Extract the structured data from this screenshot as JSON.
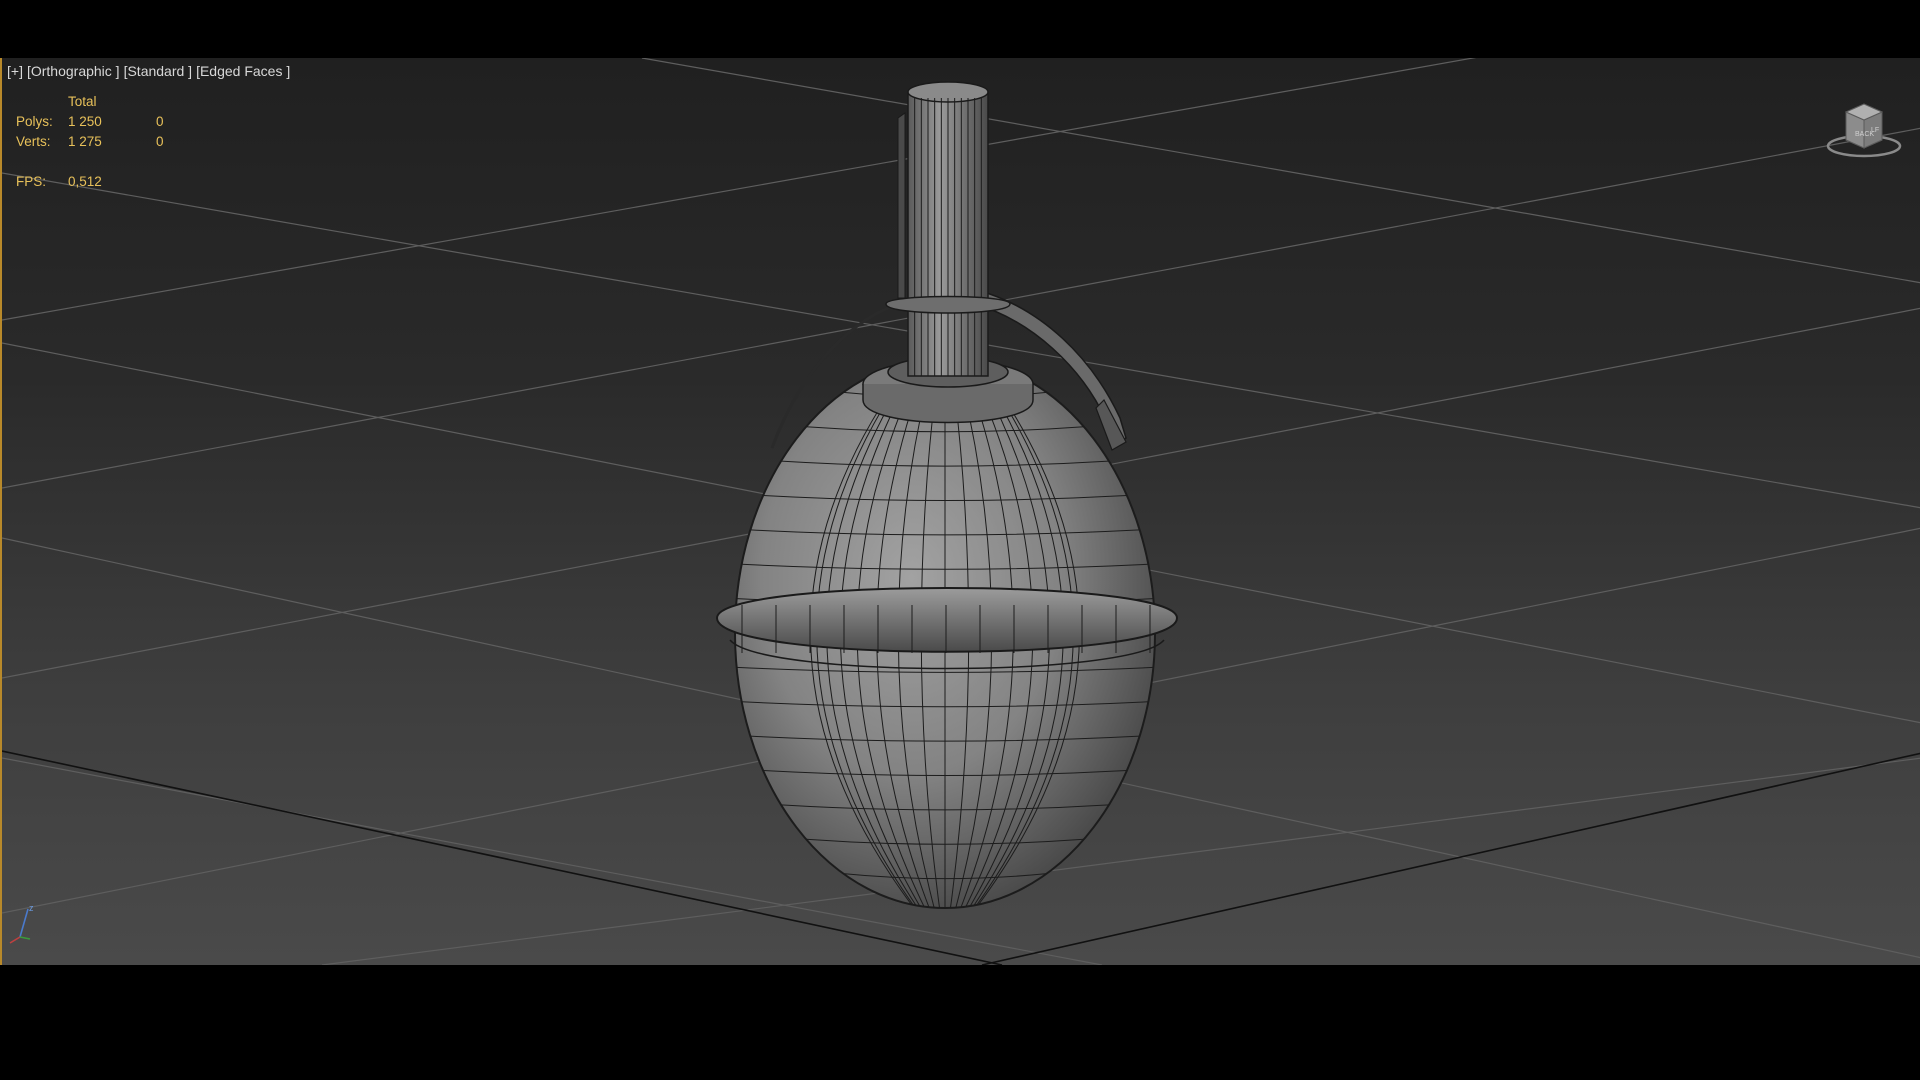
{
  "viewport": {
    "labels": [
      "[+]",
      "[Orthographic ]",
      "[Standard ]",
      "[Edged Faces ]"
    ]
  },
  "stats": {
    "header": "Total",
    "polys_label": "Polys:",
    "polys_total": "1 250",
    "polys_selected": "0",
    "verts_label": "Verts:",
    "verts_total": "1 275",
    "verts_selected": "0",
    "fps_label": "FPS:",
    "fps_value": "0,512"
  },
  "viewcube": {
    "front_label": "BACK",
    "side_label": "LF"
  },
  "axis": {
    "z_label": "z"
  },
  "colors": {
    "accent_border": "#b8892a",
    "stats_text": "#e8c15a",
    "label_text": "#d8d8d8",
    "grid_line": "#5a5a5a",
    "model_face": "#8a8a8a",
    "wire": "#1c1c1c"
  }
}
